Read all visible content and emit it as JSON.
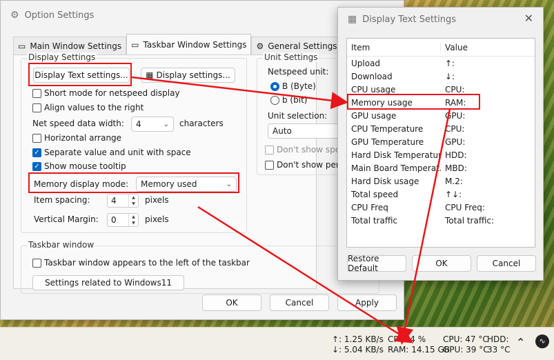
{
  "option_window": {
    "title": "Option Settings",
    "tabs": [
      {
        "label": "Main Window Settings",
        "icon": "window-icon"
      },
      {
        "label": "Taskbar Window Settings",
        "icon": "taskbar-icon"
      },
      {
        "label": "General Settings",
        "icon": "gear-icon"
      }
    ],
    "display_settings": {
      "group_label": "Display Settings",
      "display_text_btn": "Display Text settings...",
      "display_settings_btn": "Display settings...",
      "short_mode": "Short mode for netspeed display",
      "align_right": "Align values to the right",
      "net_speed_width_label": "Net speed data width:",
      "net_speed_width_value": "4",
      "characters": "characters",
      "horizontal_arrange": "Horizontal arrange",
      "separate_value": "Separate value and unit with space",
      "show_tooltip": "Show mouse tooltip",
      "memory_mode_label": "Memory display mode:",
      "memory_mode_value": "Memory used",
      "item_spacing_label": "Item spacing:",
      "item_spacing_value": "4",
      "pixels1": "pixels",
      "vertical_margin_label": "Vertical Margin:",
      "vertical_margin_value": "0",
      "pixels2": "pixels"
    },
    "unit_settings": {
      "group_label": "Unit Settings",
      "netspeed_unit": "Netspeed unit:",
      "byte": "B (Byte)",
      "bit": "b (bit)",
      "unit_selection": "Unit selection:",
      "unit_value": "Auto",
      "dont_show_speed": "Don't show speed",
      "dont_show_percent": "Don't show perce"
    },
    "taskbar_window": {
      "group_label": "Taskbar window",
      "left_of_taskbar": "Taskbar window appears to the left of the taskbar",
      "win11_btn": "Settings related to Windows11"
    },
    "ok": "OK",
    "cancel": "Cancel",
    "apply": "Apply"
  },
  "display_text_window": {
    "title": "Display Text Settings",
    "col_item": "Item",
    "col_value": "Value",
    "rows": [
      {
        "item": "Upload",
        "value": "↑:"
      },
      {
        "item": "Download",
        "value": "↓:"
      },
      {
        "item": "CPU usage",
        "value": "CPU:"
      },
      {
        "item": "Memory usage",
        "value": "RAM:"
      },
      {
        "item": "GPU usage",
        "value": "GPU:"
      },
      {
        "item": "CPU Temperature",
        "value": "CPU:"
      },
      {
        "item": "GPU Temperature",
        "value": "GPU:"
      },
      {
        "item": "Hard Disk Temperature",
        "value": "HDD:"
      },
      {
        "item": "Main Board Temperat...",
        "value": "MBD:"
      },
      {
        "item": "Hard Disk usage",
        "value": "M.2:"
      },
      {
        "item": "Total speed",
        "value": "↑↓:"
      },
      {
        "item": "CPU Freq",
        "value": "CPU Freq:"
      },
      {
        "item": "Total traffic",
        "value": "Total traffic:"
      }
    ],
    "restore": "Restore Default",
    "ok": "OK",
    "cancel": "Cancel"
  },
  "taskbar": {
    "up": "↑: 1.25 KB/s",
    "down": "↓: 5.04 KB/s",
    "cpu": "CPU: 4 %",
    "ram": "RAM: 14.15 GB",
    "cpu_temp": "CPU: 47 °C",
    "hdd": "HDD:",
    "gpu_temp": "GPU: 39 °C",
    "hdd_temp": "33 °C"
  },
  "colors": {
    "highlight": "#e8151a",
    "accent": "#0067c0"
  }
}
